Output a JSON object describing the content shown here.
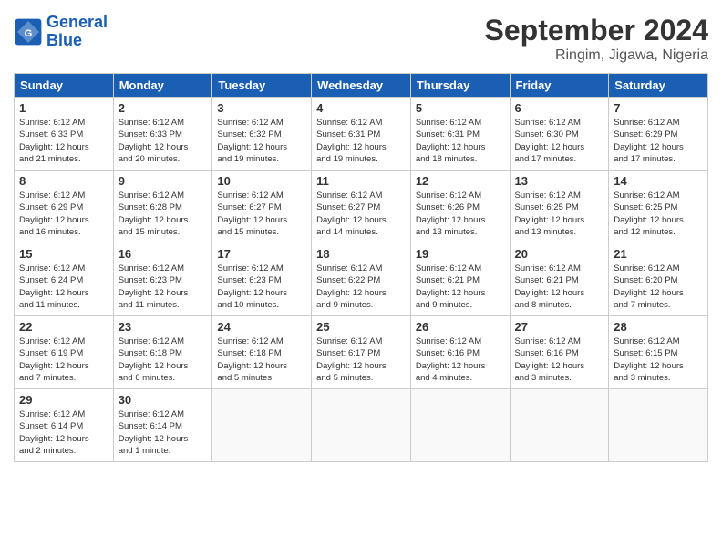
{
  "logo": {
    "text1": "General",
    "text2": "Blue"
  },
  "title": "September 2024",
  "location": "Ringim, Jigawa, Nigeria",
  "headers": [
    "Sunday",
    "Monday",
    "Tuesday",
    "Wednesday",
    "Thursday",
    "Friday",
    "Saturday"
  ],
  "weeks": [
    [
      {
        "day": "1",
        "sunrise": "6:12 AM",
        "sunset": "6:33 PM",
        "daylight": "12 hours and 21 minutes."
      },
      {
        "day": "2",
        "sunrise": "6:12 AM",
        "sunset": "6:33 PM",
        "daylight": "12 hours and 20 minutes."
      },
      {
        "day": "3",
        "sunrise": "6:12 AM",
        "sunset": "6:32 PM",
        "daylight": "12 hours and 19 minutes."
      },
      {
        "day": "4",
        "sunrise": "6:12 AM",
        "sunset": "6:31 PM",
        "daylight": "12 hours and 19 minutes."
      },
      {
        "day": "5",
        "sunrise": "6:12 AM",
        "sunset": "6:31 PM",
        "daylight": "12 hours and 18 minutes."
      },
      {
        "day": "6",
        "sunrise": "6:12 AM",
        "sunset": "6:30 PM",
        "daylight": "12 hours and 17 minutes."
      },
      {
        "day": "7",
        "sunrise": "6:12 AM",
        "sunset": "6:29 PM",
        "daylight": "12 hours and 17 minutes."
      }
    ],
    [
      {
        "day": "8",
        "sunrise": "6:12 AM",
        "sunset": "6:29 PM",
        "daylight": "12 hours and 16 minutes."
      },
      {
        "day": "9",
        "sunrise": "6:12 AM",
        "sunset": "6:28 PM",
        "daylight": "12 hours and 15 minutes."
      },
      {
        "day": "10",
        "sunrise": "6:12 AM",
        "sunset": "6:27 PM",
        "daylight": "12 hours and 15 minutes."
      },
      {
        "day": "11",
        "sunrise": "6:12 AM",
        "sunset": "6:27 PM",
        "daylight": "12 hours and 14 minutes."
      },
      {
        "day": "12",
        "sunrise": "6:12 AM",
        "sunset": "6:26 PM",
        "daylight": "12 hours and 13 minutes."
      },
      {
        "day": "13",
        "sunrise": "6:12 AM",
        "sunset": "6:25 PM",
        "daylight": "12 hours and 13 minutes."
      },
      {
        "day": "14",
        "sunrise": "6:12 AM",
        "sunset": "6:25 PM",
        "daylight": "12 hours and 12 minutes."
      }
    ],
    [
      {
        "day": "15",
        "sunrise": "6:12 AM",
        "sunset": "6:24 PM",
        "daylight": "12 hours and 11 minutes."
      },
      {
        "day": "16",
        "sunrise": "6:12 AM",
        "sunset": "6:23 PM",
        "daylight": "12 hours and 11 minutes."
      },
      {
        "day": "17",
        "sunrise": "6:12 AM",
        "sunset": "6:23 PM",
        "daylight": "12 hours and 10 minutes."
      },
      {
        "day": "18",
        "sunrise": "6:12 AM",
        "sunset": "6:22 PM",
        "daylight": "12 hours and 9 minutes."
      },
      {
        "day": "19",
        "sunrise": "6:12 AM",
        "sunset": "6:21 PM",
        "daylight": "12 hours and 9 minutes."
      },
      {
        "day": "20",
        "sunrise": "6:12 AM",
        "sunset": "6:21 PM",
        "daylight": "12 hours and 8 minutes."
      },
      {
        "day": "21",
        "sunrise": "6:12 AM",
        "sunset": "6:20 PM",
        "daylight": "12 hours and 7 minutes."
      }
    ],
    [
      {
        "day": "22",
        "sunrise": "6:12 AM",
        "sunset": "6:19 PM",
        "daylight": "12 hours and 7 minutes."
      },
      {
        "day": "23",
        "sunrise": "6:12 AM",
        "sunset": "6:18 PM",
        "daylight": "12 hours and 6 minutes."
      },
      {
        "day": "24",
        "sunrise": "6:12 AM",
        "sunset": "6:18 PM",
        "daylight": "12 hours and 5 minutes."
      },
      {
        "day": "25",
        "sunrise": "6:12 AM",
        "sunset": "6:17 PM",
        "daylight": "12 hours and 5 minutes."
      },
      {
        "day": "26",
        "sunrise": "6:12 AM",
        "sunset": "6:16 PM",
        "daylight": "12 hours and 4 minutes."
      },
      {
        "day": "27",
        "sunrise": "6:12 AM",
        "sunset": "6:16 PM",
        "daylight": "12 hours and 3 minutes."
      },
      {
        "day": "28",
        "sunrise": "6:12 AM",
        "sunset": "6:15 PM",
        "daylight": "12 hours and 3 minutes."
      }
    ],
    [
      {
        "day": "29",
        "sunrise": "6:12 AM",
        "sunset": "6:14 PM",
        "daylight": "12 hours and 2 minutes."
      },
      {
        "day": "30",
        "sunrise": "6:12 AM",
        "sunset": "6:14 PM",
        "daylight": "12 hours and 1 minute."
      },
      null,
      null,
      null,
      null,
      null
    ]
  ]
}
